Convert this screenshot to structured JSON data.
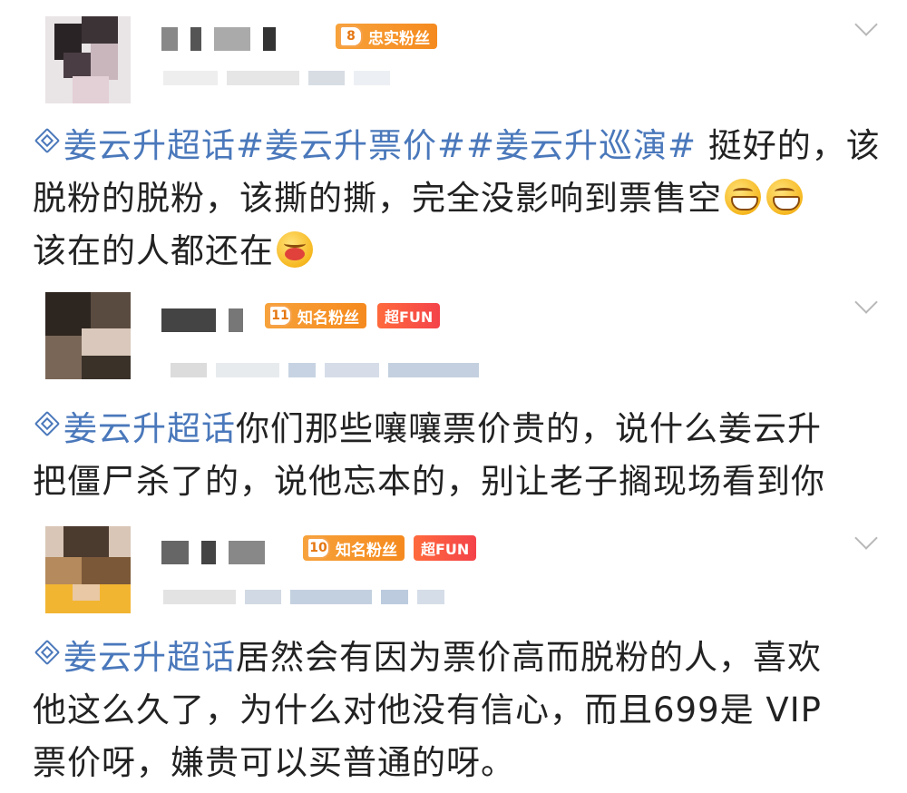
{
  "posts": [
    {
      "badges": {
        "fan_level": "8",
        "fan_label": "忠实粉丝"
      },
      "topic": "姜云升超话",
      "hashtags": [
        "#姜云升票价#",
        "#姜云升巡演#"
      ],
      "body_lines": [
        "挺好的，该",
        "脱粉的脱粉，该撕的撕，完全没影响到票售空",
        "该在的人都还在"
      ],
      "emojis": [
        "grin-emoji",
        "grin-emoji",
        "hug-emoji"
      ]
    },
    {
      "badges": {
        "fan_level": "11",
        "fan_label": "知名粉丝",
        "super_label": "超FUN"
      },
      "topic": "姜云升超话",
      "body_lines": [
        "你们那些嚷嚷票价贵的，说什么姜云升",
        "把僵尸杀了的，说他忘本的，别让老子搁现场看到你"
      ]
    },
    {
      "badges": {
        "fan_level": "10",
        "fan_label": "知名粉丝",
        "super_label": "超FUN"
      },
      "topic": "姜云升超话",
      "body_lines": [
        "居然会有因为票价高而脱粉的人，喜欢",
        "他这么久了，为什么对他没有信心，而且699是 VIP",
        "票价呀，嫌贵可以买普通的呀。"
      ]
    }
  ],
  "colors": {
    "topic": "#4a78bb",
    "fan_badge": "#f58a1f",
    "superfun_badge": "#f4434a"
  }
}
